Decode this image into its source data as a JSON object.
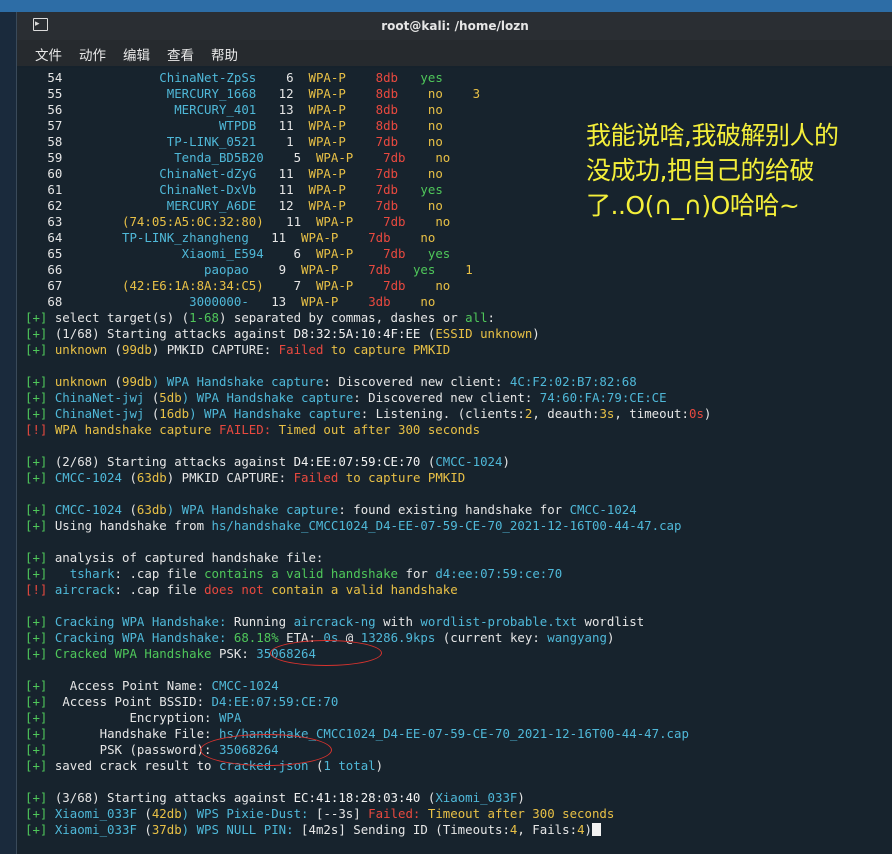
{
  "window": {
    "title": "root@kali: /home/lozn"
  },
  "menu": [
    "文件",
    "动作",
    "编辑",
    "查看",
    "帮助"
  ],
  "icons": {
    "terminal": "terminal-icon"
  },
  "colors": {
    "green": "#4fc75a",
    "cyan": "#4fb8d8",
    "red": "#e8493f",
    "yellow": "#e8c046",
    "overlay_text": "#f4ef3a"
  },
  "overlay": {
    "lines": [
      "我能说啥,我破解别人的",
      "没成功,把自己的给破",
      "了..O(∩_∩)O哈哈~"
    ]
  },
  "terminal_lines": [
    [
      {
        "t": "   54             ",
        "c": ""
      },
      {
        "t": "ChinaNet-ZpSs",
        "c": "c"
      },
      {
        "t": "    6  ",
        "c": ""
      },
      {
        "t": "WPA-P",
        "c": "y"
      },
      {
        "t": "    ",
        "c": ""
      },
      {
        "t": "8db",
        "c": "r"
      },
      {
        "t": "   ",
        "c": ""
      },
      {
        "t": "yes",
        "c": "g"
      }
    ],
    [
      {
        "t": "   55              ",
        "c": ""
      },
      {
        "t": "MERCURY_1668",
        "c": "c"
      },
      {
        "t": "   12  ",
        "c": ""
      },
      {
        "t": "WPA-P",
        "c": "y"
      },
      {
        "t": "    ",
        "c": ""
      },
      {
        "t": "8db",
        "c": "r"
      },
      {
        "t": "    ",
        "c": ""
      },
      {
        "t": "no",
        "c": "y"
      },
      {
        "t": "    ",
        "c": ""
      },
      {
        "t": "3",
        "c": "y"
      }
    ],
    [
      {
        "t": "   56               ",
        "c": ""
      },
      {
        "t": "MERCURY_401",
        "c": "c"
      },
      {
        "t": "   13  ",
        "c": ""
      },
      {
        "t": "WPA-P",
        "c": "y"
      },
      {
        "t": "    ",
        "c": ""
      },
      {
        "t": "8db",
        "c": "r"
      },
      {
        "t": "    ",
        "c": ""
      },
      {
        "t": "no",
        "c": "y"
      }
    ],
    [
      {
        "t": "   57                     ",
        "c": ""
      },
      {
        "t": "WTPDB",
        "c": "c"
      },
      {
        "t": "   11  ",
        "c": ""
      },
      {
        "t": "WPA-P",
        "c": "y"
      },
      {
        "t": "    ",
        "c": ""
      },
      {
        "t": "8db",
        "c": "r"
      },
      {
        "t": "    ",
        "c": ""
      },
      {
        "t": "no",
        "c": "y"
      }
    ],
    [
      {
        "t": "   58              ",
        "c": ""
      },
      {
        "t": "TP-LINK_0521",
        "c": "c"
      },
      {
        "t": "    1  ",
        "c": ""
      },
      {
        "t": "WPA-P",
        "c": "y"
      },
      {
        "t": "    ",
        "c": ""
      },
      {
        "t": "7db",
        "c": "r"
      },
      {
        "t": "    ",
        "c": ""
      },
      {
        "t": "no",
        "c": "y"
      }
    ],
    [
      {
        "t": "   59               ",
        "c": ""
      },
      {
        "t": "Tenda_BD5B20",
        "c": "c"
      },
      {
        "t": "    5  ",
        "c": ""
      },
      {
        "t": "WPA-P",
        "c": "y"
      },
      {
        "t": "    ",
        "c": ""
      },
      {
        "t": "7db",
        "c": "r"
      },
      {
        "t": "    ",
        "c": ""
      },
      {
        "t": "no",
        "c": "y"
      }
    ],
    [
      {
        "t": "   60             ",
        "c": ""
      },
      {
        "t": "ChinaNet-dZyG",
        "c": "c"
      },
      {
        "t": "   11  ",
        "c": ""
      },
      {
        "t": "WPA-P",
        "c": "y"
      },
      {
        "t": "    ",
        "c": ""
      },
      {
        "t": "7db",
        "c": "r"
      },
      {
        "t": "    ",
        "c": ""
      },
      {
        "t": "no",
        "c": "y"
      }
    ],
    [
      {
        "t": "   61             ",
        "c": ""
      },
      {
        "t": "ChinaNet-DxVb",
        "c": "c"
      },
      {
        "t": "   11  ",
        "c": ""
      },
      {
        "t": "WPA-P",
        "c": "y"
      },
      {
        "t": "    ",
        "c": ""
      },
      {
        "t": "7db",
        "c": "r"
      },
      {
        "t": "   ",
        "c": ""
      },
      {
        "t": "yes",
        "c": "g"
      }
    ],
    [
      {
        "t": "   62              ",
        "c": ""
      },
      {
        "t": "MERCURY_A6DE",
        "c": "c"
      },
      {
        "t": "   12  ",
        "c": ""
      },
      {
        "t": "WPA-P",
        "c": "y"
      },
      {
        "t": "    ",
        "c": ""
      },
      {
        "t": "7db",
        "c": "r"
      },
      {
        "t": "    ",
        "c": ""
      },
      {
        "t": "no",
        "c": "y"
      }
    ],
    [
      {
        "t": "   63        ",
        "c": ""
      },
      {
        "t": "(74:05:A5:0C:32:80)",
        "c": "y"
      },
      {
        "t": "   11  ",
        "c": ""
      },
      {
        "t": "WPA-P",
        "c": "y"
      },
      {
        "t": "    ",
        "c": ""
      },
      {
        "t": "7db",
        "c": "r"
      },
      {
        "t": "    ",
        "c": ""
      },
      {
        "t": "no",
        "c": "y"
      }
    ],
    [
      {
        "t": "   64        ",
        "c": ""
      },
      {
        "t": "TP-LINK_zhangheng",
        "c": "c"
      },
      {
        "t": "   11  ",
        "c": ""
      },
      {
        "t": "WPA-P",
        "c": "y"
      },
      {
        "t": "    ",
        "c": ""
      },
      {
        "t": "7db",
        "c": "r"
      },
      {
        "t": "    ",
        "c": ""
      },
      {
        "t": "no",
        "c": "y"
      }
    ],
    [
      {
        "t": "   65                ",
        "c": ""
      },
      {
        "t": "Xiaomi_E594",
        "c": "c"
      },
      {
        "t": "    6  ",
        "c": ""
      },
      {
        "t": "WPA-P",
        "c": "y"
      },
      {
        "t": "    ",
        "c": ""
      },
      {
        "t": "7db",
        "c": "r"
      },
      {
        "t": "   ",
        "c": ""
      },
      {
        "t": "yes",
        "c": "g"
      }
    ],
    [
      {
        "t": "   66                   ",
        "c": ""
      },
      {
        "t": "paopao",
        "c": "c"
      },
      {
        "t": "    9  ",
        "c": ""
      },
      {
        "t": "WPA-P",
        "c": "y"
      },
      {
        "t": "    ",
        "c": ""
      },
      {
        "t": "7db",
        "c": "r"
      },
      {
        "t": "   ",
        "c": ""
      },
      {
        "t": "yes",
        "c": "g"
      },
      {
        "t": "    ",
        "c": ""
      },
      {
        "t": "1",
        "c": "y"
      }
    ],
    [
      {
        "t": "   67        ",
        "c": ""
      },
      {
        "t": "(42:E6:1A:8A:34:C5)",
        "c": "y"
      },
      {
        "t": "    7  ",
        "c": ""
      },
      {
        "t": "WPA-P",
        "c": "y"
      },
      {
        "t": "    ",
        "c": ""
      },
      {
        "t": "7db",
        "c": "r"
      },
      {
        "t": "    ",
        "c": ""
      },
      {
        "t": "no",
        "c": "y"
      }
    ],
    [
      {
        "t": "   68                 ",
        "c": ""
      },
      {
        "t": "3000000-",
        "c": "c"
      },
      {
        "t": "   13  ",
        "c": ""
      },
      {
        "t": "WPA-P",
        "c": "y"
      },
      {
        "t": "    ",
        "c": ""
      },
      {
        "t": "3db",
        "c": "r"
      },
      {
        "t": "    ",
        "c": ""
      },
      {
        "t": "no",
        "c": "y"
      }
    ],
    [
      {
        "t": "[+] ",
        "c": "g"
      },
      {
        "t": "select target(s) (",
        "c": ""
      },
      {
        "t": "1-68",
        "c": "g"
      },
      {
        "t": ") separated by commas, dashes or ",
        "c": ""
      },
      {
        "t": "all",
        "c": "g"
      },
      {
        "t": ":",
        "c": ""
      }
    ],
    [
      {
        "t": "[+] ",
        "c": "g"
      },
      {
        "t": "(1/68) Starting attacks against ",
        "c": ""
      },
      {
        "t": "D8:32:5A:10:4F:EE",
        "c": "w"
      },
      {
        "t": " (",
        "c": ""
      },
      {
        "t": "ESSID unknown",
        "c": "y"
      },
      {
        "t": ")",
        "c": ""
      }
    ],
    [
      {
        "t": "[+] ",
        "c": "g"
      },
      {
        "t": "unknown",
        "c": "y"
      },
      {
        "t": " (",
        "c": ""
      },
      {
        "t": "99db",
        "c": "y"
      },
      {
        "t": ") PMKID CAPTURE: ",
        "c": ""
      },
      {
        "t": "Failed",
        "c": "r"
      },
      {
        "t": " to capture PMKID",
        "c": "y"
      }
    ],
    [],
    [
      {
        "t": "[+] ",
        "c": "g"
      },
      {
        "t": "unknown",
        "c": "y"
      },
      {
        "t": " (",
        "c": ""
      },
      {
        "t": "99db",
        "c": "y"
      },
      {
        "t": ") WPA Handshake capture",
        "c": "c"
      },
      {
        "t": ": Discovered new client: ",
        "c": ""
      },
      {
        "t": "4C:F2:02:B7:82:68",
        "c": "c"
      }
    ],
    [
      {
        "t": "[+] ",
        "c": "g"
      },
      {
        "t": "ChinaNet-jwj",
        "c": "c"
      },
      {
        "t": " (",
        "c": ""
      },
      {
        "t": "5db",
        "c": "y"
      },
      {
        "t": ") WPA Handshake capture",
        "c": "c"
      },
      {
        "t": ": Discovered new client: ",
        "c": ""
      },
      {
        "t": "74:60:FA:79:CE:CE",
        "c": "c"
      }
    ],
    [
      {
        "t": "[+] ",
        "c": "g"
      },
      {
        "t": "ChinaNet-jwj",
        "c": "c"
      },
      {
        "t": " (",
        "c": ""
      },
      {
        "t": "16db",
        "c": "y"
      },
      {
        "t": ") WPA Handshake capture",
        "c": "c"
      },
      {
        "t": ": Listening. (clients:",
        "c": ""
      },
      {
        "t": "2",
        "c": "y"
      },
      {
        "t": ", deauth:",
        "c": ""
      },
      {
        "t": "3s",
        "c": "y"
      },
      {
        "t": ", timeout:",
        "c": ""
      },
      {
        "t": "0s",
        "c": "r"
      },
      {
        "t": ")",
        "c": ""
      }
    ],
    [
      {
        "t": "[!] ",
        "c": "r"
      },
      {
        "t": "WPA handshake capture ",
        "c": "y"
      },
      {
        "t": "FAILED:",
        "c": "r"
      },
      {
        "t": " Timed out after 300 seconds",
        "c": "y"
      }
    ],
    [],
    [
      {
        "t": "[+] ",
        "c": "g"
      },
      {
        "t": "(2/68) Starting attacks against ",
        "c": ""
      },
      {
        "t": "D4:EE:07:59:CE:70",
        "c": "w"
      },
      {
        "t": " (",
        "c": ""
      },
      {
        "t": "CMCC-1024",
        "c": "c"
      },
      {
        "t": ")",
        "c": ""
      }
    ],
    [
      {
        "t": "[+] ",
        "c": "g"
      },
      {
        "t": "CMCC-1024",
        "c": "c"
      },
      {
        "t": " (",
        "c": ""
      },
      {
        "t": "63db",
        "c": "y"
      },
      {
        "t": ") PMKID CAPTURE: ",
        "c": ""
      },
      {
        "t": "Failed",
        "c": "r"
      },
      {
        "t": " to capture PMKID",
        "c": "y"
      }
    ],
    [],
    [
      {
        "t": "[+] ",
        "c": "g"
      },
      {
        "t": "CMCC-1024",
        "c": "c"
      },
      {
        "t": " (",
        "c": ""
      },
      {
        "t": "63db",
        "c": "y"
      },
      {
        "t": ") WPA Handshake capture",
        "c": "c"
      },
      {
        "t": ": found existing handshake for ",
        "c": ""
      },
      {
        "t": "CMCC-1024",
        "c": "c"
      }
    ],
    [
      {
        "t": "[+] ",
        "c": "g"
      },
      {
        "t": "Using handshake from ",
        "c": ""
      },
      {
        "t": "hs/handshake_CMCC1024_D4-EE-07-59-CE-70_2021-12-16T00-44-47.cap",
        "c": "c"
      }
    ],
    [],
    [
      {
        "t": "[+] ",
        "c": "g"
      },
      {
        "t": "analysis of captured handshake file:",
        "c": ""
      }
    ],
    [
      {
        "t": "[+]   ",
        "c": "g"
      },
      {
        "t": "tshark",
        "c": "c"
      },
      {
        "t": ": .cap file ",
        "c": ""
      },
      {
        "t": "contains a valid handshake",
        "c": "g"
      },
      {
        "t": " for ",
        "c": ""
      },
      {
        "t": "d4:ee:07:59:ce:70",
        "c": "c"
      }
    ],
    [
      {
        "t": "[!] ",
        "c": "r"
      },
      {
        "t": "aircrack",
        "c": "c"
      },
      {
        "t": ": .cap file ",
        "c": ""
      },
      {
        "t": "does not",
        "c": "r"
      },
      {
        "t": " contain a valid handshake",
        "c": "y"
      }
    ],
    [],
    [
      {
        "t": "[+] ",
        "c": "g"
      },
      {
        "t": "Cracking WPA Handshake:",
        "c": "c"
      },
      {
        "t": " Running ",
        "c": ""
      },
      {
        "t": "aircrack-ng",
        "c": "c"
      },
      {
        "t": " with ",
        "c": ""
      },
      {
        "t": "wordlist-probable.txt",
        "c": "c"
      },
      {
        "t": " wordlist",
        "c": ""
      }
    ],
    [
      {
        "t": "[+] ",
        "c": "g"
      },
      {
        "t": "Cracking WPA Handshake: ",
        "c": "c"
      },
      {
        "t": "68.18%",
        "c": "g"
      },
      {
        "t": " ETA: ",
        "c": ""
      },
      {
        "t": "0s",
        "c": "c"
      },
      {
        "t": " @ ",
        "c": ""
      },
      {
        "t": "13286.9kps",
        "c": "c"
      },
      {
        "t": " (current key: ",
        "c": ""
      },
      {
        "t": "wangyang",
        "c": "c"
      },
      {
        "t": ")",
        "c": ""
      }
    ],
    [
      {
        "t": "[+] ",
        "c": "g"
      },
      {
        "t": "Cracked WPA Handshake",
        "c": "g"
      },
      {
        "t": " PSK: ",
        "c": ""
      },
      {
        "t": "35068264",
        "c": "c"
      }
    ],
    [],
    [
      {
        "t": "[+]   ",
        "c": "g"
      },
      {
        "t": "Access Point Name: ",
        "c": ""
      },
      {
        "t": "CMCC-1024",
        "c": "c"
      }
    ],
    [
      {
        "t": "[+]  ",
        "c": "g"
      },
      {
        "t": "Access Point BSSID: ",
        "c": ""
      },
      {
        "t": "D4:EE:07:59:CE:70",
        "c": "c"
      }
    ],
    [
      {
        "t": "[+]           ",
        "c": "g"
      },
      {
        "t": "Encryption: ",
        "c": ""
      },
      {
        "t": "WPA",
        "c": "c"
      }
    ],
    [
      {
        "t": "[+]       ",
        "c": "g"
      },
      {
        "t": "Handshake File: ",
        "c": ""
      },
      {
        "t": "hs/handshake_CMCC1024_D4-EE-07-59-CE-70_2021-12-16T00-44-47.cap",
        "c": "c"
      }
    ],
    [
      {
        "t": "[+]       ",
        "c": "g"
      },
      {
        "t": "PSK (password): ",
        "c": ""
      },
      {
        "t": "35068264",
        "c": "c"
      }
    ],
    [
      {
        "t": "[+] ",
        "c": "g"
      },
      {
        "t": "saved crack result to ",
        "c": ""
      },
      {
        "t": "cracked.json",
        "c": "c"
      },
      {
        "t": " (",
        "c": ""
      },
      {
        "t": "1 total",
        "c": "c"
      },
      {
        "t": ")",
        "c": ""
      }
    ],
    [],
    [
      {
        "t": "[+] ",
        "c": "g"
      },
      {
        "t": "(3/68) Starting attacks against ",
        "c": ""
      },
      {
        "t": "EC:41:18:28:03:40",
        "c": "w"
      },
      {
        "t": " (",
        "c": ""
      },
      {
        "t": "Xiaomi_033F",
        "c": "c"
      },
      {
        "t": ")",
        "c": ""
      }
    ],
    [
      {
        "t": "[+] ",
        "c": "g"
      },
      {
        "t": "Xiaomi_033F",
        "c": "c"
      },
      {
        "t": " (",
        "c": ""
      },
      {
        "t": "42db",
        "c": "y"
      },
      {
        "t": ") WPS Pixie-Dust: ",
        "c": "c"
      },
      {
        "t": "[--3s] ",
        "c": ""
      },
      {
        "t": "Failed: ",
        "c": "r"
      },
      {
        "t": "Timeout after 300 seconds",
        "c": "y"
      }
    ],
    [
      {
        "t": "[+] ",
        "c": "g"
      },
      {
        "t": "Xiaomi_033F",
        "c": "c"
      },
      {
        "t": " (",
        "c": ""
      },
      {
        "t": "37db",
        "c": "y"
      },
      {
        "t": ") WPS NULL PIN: ",
        "c": "c"
      },
      {
        "t": "[4m2s] ",
        "c": ""
      },
      {
        "t": "Sending ID (Timeouts:",
        "c": ""
      },
      {
        "t": "4",
        "c": "y"
      },
      {
        "t": ", Fails:",
        "c": ""
      },
      {
        "t": "4",
        "c": "y"
      },
      {
        "t": ")",
        "c": ""
      },
      {
        "t": " ",
        "c": "cursor"
      }
    ]
  ]
}
